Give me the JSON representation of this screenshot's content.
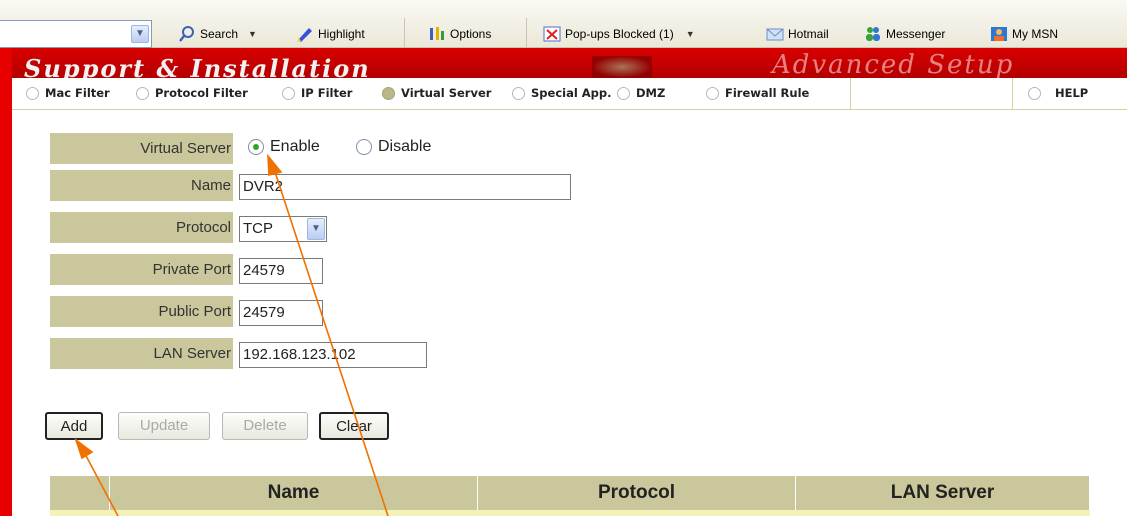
{
  "toolbar": {
    "items": [
      {
        "label": "Search",
        "icon": "search-icon"
      },
      {
        "label": "Highlight",
        "icon": "highlight-icon"
      },
      {
        "label": "Options",
        "icon": "options-icon"
      },
      {
        "label": "Pop-ups Blocked (1)",
        "icon": "popup-blocker-icon"
      },
      {
        "label": "Hotmail",
        "icon": "hotmail-icon"
      },
      {
        "label": "Messenger",
        "icon": "messenger-icon"
      },
      {
        "label": "My MSN",
        "icon": "msn-icon"
      }
    ]
  },
  "tabs": [
    {
      "label": "Mac Filter",
      "selected": false
    },
    {
      "label": "Protocol Filter",
      "selected": false
    },
    {
      "label": "IP Filter",
      "selected": false
    },
    {
      "label": "Virtual Server",
      "selected": true
    },
    {
      "label": "Special App.",
      "selected": false
    },
    {
      "label": "DMZ",
      "selected": false
    },
    {
      "label": "Firewall Rule",
      "selected": false
    }
  ],
  "help_label": "HELP",
  "form": {
    "virtual_server": {
      "label": "Virtual Server",
      "enable": "Enable",
      "disable": "Disable",
      "selected": "Enable"
    },
    "name": {
      "label": "Name",
      "value": "DVR2"
    },
    "protocol": {
      "label": "Protocol",
      "value": "TCP"
    },
    "private_port": {
      "label": "Private Port",
      "value": "24579"
    },
    "public_port": {
      "label": "Public Port",
      "value": "24579"
    },
    "lan_server": {
      "label": "LAN Server",
      "value": "192.168.123.102"
    }
  },
  "buttons": {
    "add": "Add",
    "update": "Update",
    "delete": "Delete",
    "clear": "Clear"
  },
  "table": {
    "columns": [
      "",
      "Name",
      "Protocol",
      "LAN Server"
    ]
  },
  "colors": {
    "accent_red": "#e60000",
    "label_bg": "#c9c79b",
    "annotation_arrow": "#f07000"
  }
}
